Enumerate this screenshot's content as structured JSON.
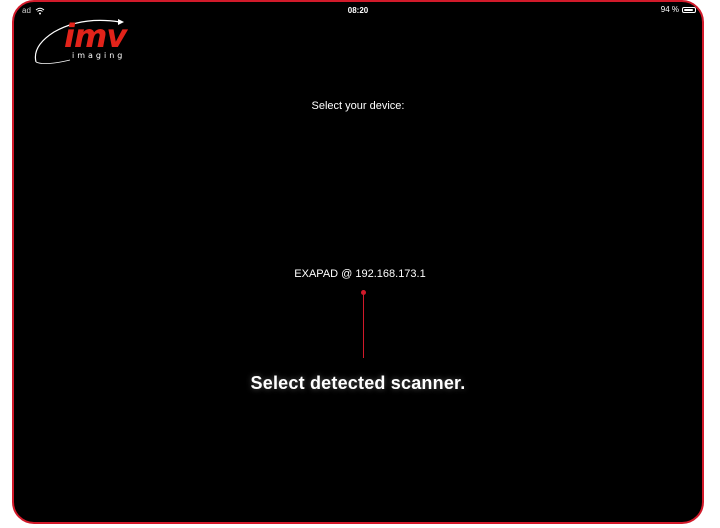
{
  "status_bar": {
    "carrier": "ad",
    "time": "08:20",
    "battery": "94 %",
    "battery_level": 0.94
  },
  "logo": {
    "brand": "imv",
    "sub": "imaging"
  },
  "main": {
    "prompt": "Select your device:",
    "devices": [
      {
        "label": "EXAPAD @ 192.168.173.1"
      }
    ]
  },
  "annotation": {
    "text": "Select detected scanner."
  },
  "colors": {
    "accent": "#d11a2a",
    "brand_red": "#e2231a",
    "background": "#000000",
    "text": "#ffffff"
  }
}
